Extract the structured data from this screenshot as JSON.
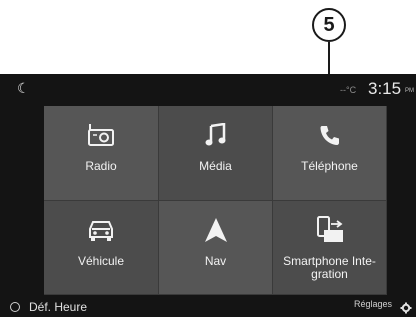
{
  "callout": {
    "number": "5"
  },
  "status": {
    "temperature": "--°C",
    "time": "3:15",
    "meridiem": "PM"
  },
  "tiles": [
    {
      "label": "Radio",
      "icon": "radio-icon"
    },
    {
      "label": "Média",
      "icon": "music-note-icon"
    },
    {
      "label": "Téléphone",
      "icon": "phone-handset-icon"
    },
    {
      "label": "Véhicule",
      "icon": "car-front-icon"
    },
    {
      "label": "Nav",
      "icon": "navigation-arrow-icon"
    },
    {
      "label": "Smartphone Inte-\ngration",
      "icon": "smartphone-integration-icon"
    }
  ],
  "bottom": {
    "left_label": "Déf. Heure",
    "right_label": "Réglages"
  }
}
